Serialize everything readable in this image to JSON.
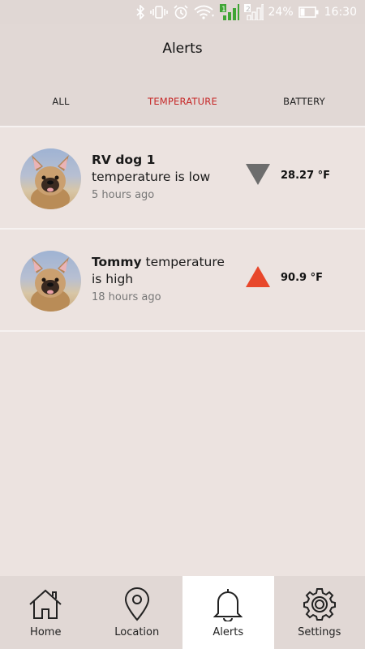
{
  "status_bar": {
    "battery": "24%",
    "time": "16:30",
    "sim1": "1",
    "sim2": "2"
  },
  "header": {
    "title": "Alerts",
    "tabs": [
      {
        "label": "ALL",
        "active": false
      },
      {
        "label": "TEMPERATURE",
        "active": true
      },
      {
        "label": "BATTERY",
        "active": false
      }
    ]
  },
  "alerts": [
    {
      "name": "RV dog 1",
      "message": " temperature is low",
      "time": "5 hours ago",
      "value": "28.27 °F",
      "trend": "down",
      "trend_color": "#6d6d6d",
      "avatar": "french-bulldog"
    },
    {
      "name": "Tommy",
      "message": " temperature is high",
      "time": "18 hours ago",
      "value": "90.9 °F",
      "trend": "up",
      "trend_color": "#e8472b",
      "avatar": "french-bulldog"
    }
  ],
  "nav": [
    {
      "label": "Home",
      "icon": "home-icon",
      "active": false
    },
    {
      "label": "Location",
      "icon": "location-pin-icon",
      "active": false
    },
    {
      "label": "Alerts",
      "icon": "bell-icon",
      "active": true
    },
    {
      "label": "Settings",
      "icon": "gear-icon",
      "active": false
    }
  ]
}
